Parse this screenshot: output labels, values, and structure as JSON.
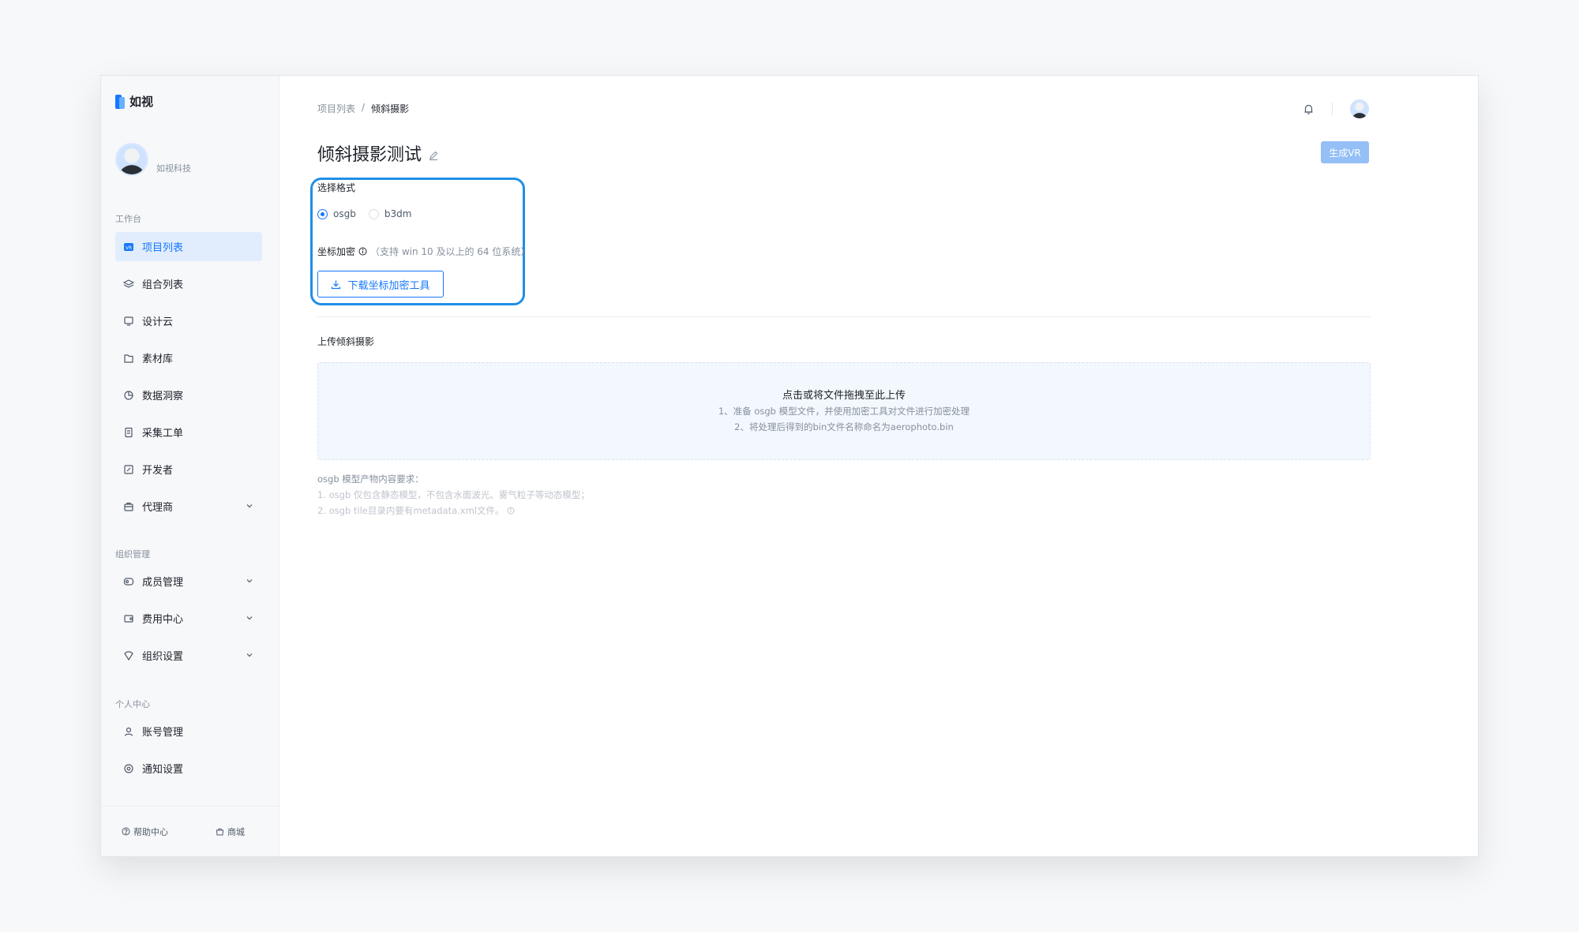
{
  "brand": {
    "name": "如视"
  },
  "user": {
    "org": "如视科技"
  },
  "sidebar": {
    "sections": [
      {
        "label": "工作台"
      },
      {
        "label": "组织管理"
      },
      {
        "label": "个人中心"
      }
    ],
    "workbench": [
      {
        "label": "项目列表",
        "icon": "vr-icon",
        "active": true
      },
      {
        "label": "组合列表",
        "icon": "layers-icon"
      },
      {
        "label": "设计云",
        "icon": "monitor-icon"
      },
      {
        "label": "素材库",
        "icon": "folder-icon"
      },
      {
        "label": "数据洞察",
        "icon": "pie-chart-icon"
      },
      {
        "label": "采集工单",
        "icon": "document-icon"
      },
      {
        "label": "开发者",
        "icon": "code-icon"
      },
      {
        "label": "代理商",
        "icon": "briefcase-icon"
      }
    ],
    "org": [
      {
        "label": "成员管理",
        "icon": "members-icon"
      },
      {
        "label": "费用中心",
        "icon": "wallet-icon"
      },
      {
        "label": "组织设置",
        "icon": "shield-icon"
      }
    ],
    "personal": [
      {
        "label": "账号管理",
        "icon": "user-icon"
      },
      {
        "label": "通知设置",
        "icon": "settings-icon"
      }
    ],
    "footer": {
      "help": "帮助中心",
      "shop": "商城"
    }
  },
  "breadcrumb": {
    "parent": "项目列表",
    "separator": "/",
    "current": "倾斜摄影"
  },
  "page": {
    "title": "倾斜摄影测试",
    "vr_button": "生成VR"
  },
  "format": {
    "label": "选择格式",
    "options": [
      "osgb",
      "b3dm"
    ],
    "selected": "osgb"
  },
  "encrypt": {
    "label": "坐标加密",
    "hint": "（支持 win 10 及以上的 64 位系统）",
    "button": "下载坐标加密工具"
  },
  "upload": {
    "label": "上传倾斜摄影",
    "title": "点击或将文件拖拽至此上传",
    "step1": "1、准备 osgb 模型文件，并使用加密工具对文件进行加密处理",
    "step2": "2、将处理后得到的bin文件名称命名为aerophoto.bin"
  },
  "requirements": {
    "head": "osgb 模型产物内容要求：",
    "line1": "1. osgb 仅包含静态模型，不包含水面波光、雾气粒子等动态模型；",
    "line2": "2. osgb tile目录内要有metadata.xml文件。"
  },
  "colors": {
    "accent": "#1677ff",
    "highlight_border": "#1f8fe6",
    "vr_button": "#94bff7"
  }
}
